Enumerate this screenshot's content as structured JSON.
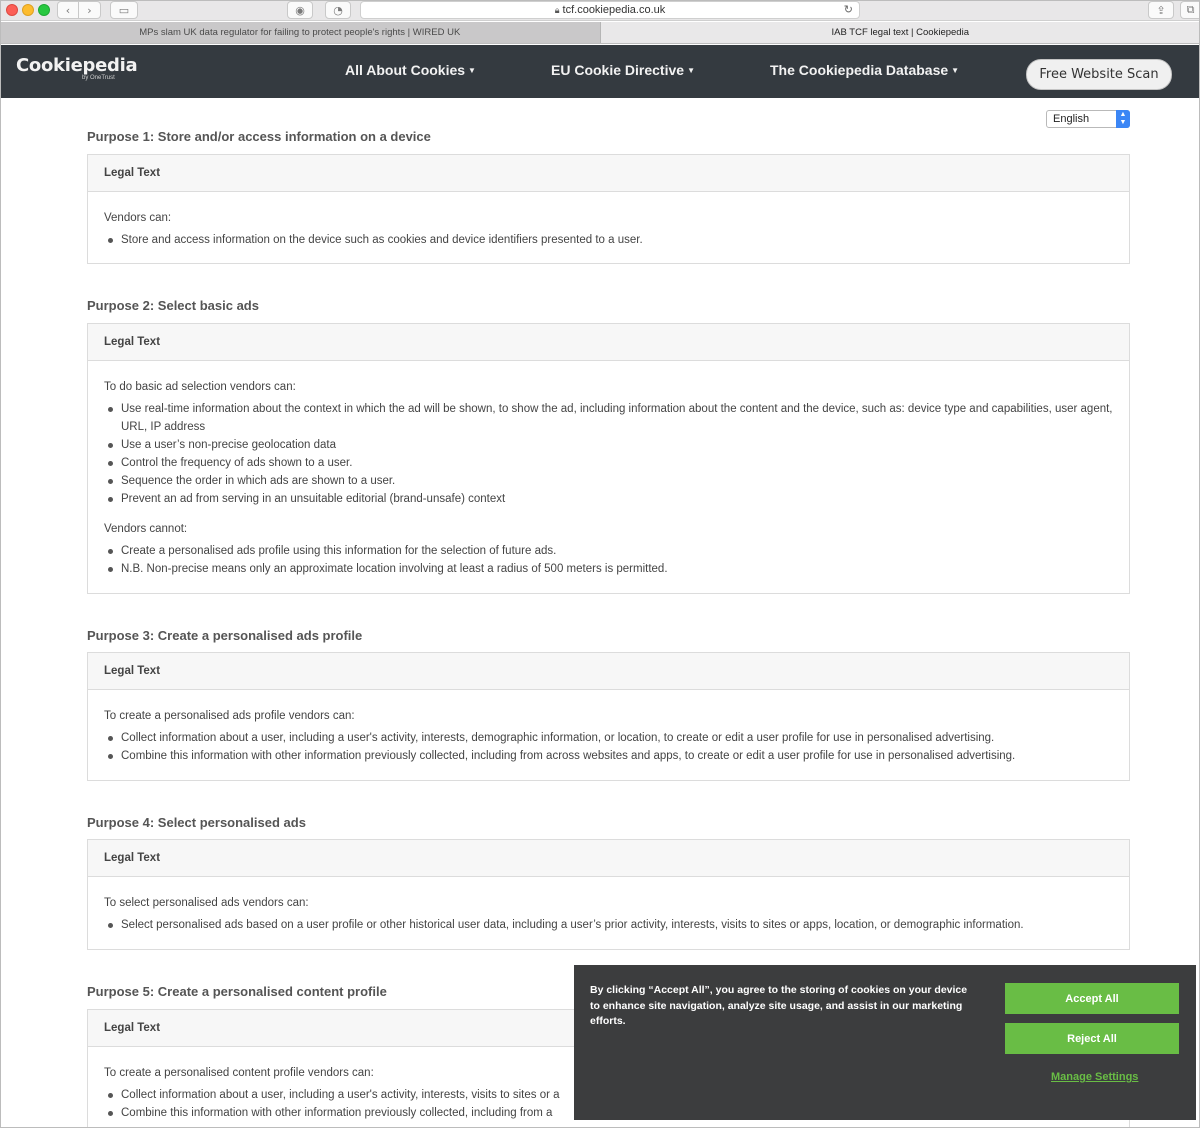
{
  "browser": {
    "url": "tcf.cookiepedia.co.uk",
    "tabs": [
      {
        "label": "MPs slam UK data regulator for failing to protect people's rights | WIRED UK",
        "active": false
      },
      {
        "label": "IAB TCF legal text | Cookiepedia",
        "active": true
      }
    ]
  },
  "header": {
    "logo": "Cookiepedia",
    "logo_sub": "by OneTrust",
    "nav": [
      "All About Cookies",
      "EU Cookie Directive",
      "The Cookiepedia Database"
    ],
    "scan_button": "Free Website Scan"
  },
  "language": {
    "selected": "English"
  },
  "purposes": [
    {
      "title": "Purpose 1: Store and/or access information on a device",
      "card_header": "Legal Text",
      "intro": "Vendors can:",
      "items": [
        "Store and access information on the device such as cookies and device identifiers presented to a user."
      ]
    },
    {
      "title": "Purpose 2: Select basic ads",
      "card_header": "Legal Text",
      "intro": "To do basic ad selection vendors can:",
      "items": [
        "Use real-time information about the context in which the ad will be shown, to show the ad, including information about the content and the device, such as: device type and capabilities, user agent, URL, IP address",
        "Use a user’s non-precise geolocation data",
        "Control the frequency of ads shown to a user.",
        "Sequence the order in which ads are shown to a user.",
        "Prevent an ad from serving in an unsuitable editorial (brand-unsafe) context"
      ],
      "intro2": "Vendors cannot:",
      "items2": [
        "Create a personalised ads profile using this information for the selection of future ads.",
        "N.B. Non-precise means only an approximate location involving at least a radius of 500 meters is permitted."
      ]
    },
    {
      "title": "Purpose 3: Create a personalised ads profile",
      "card_header": "Legal Text",
      "intro": "To create a personalised ads profile vendors can:",
      "items": [
        "Collect information about a user, including a user's activity, interests, demographic information, or location, to create or edit a user profile for use in personalised advertising.",
        "Combine this information with other information previously collected, including from across websites and apps, to create or edit a user profile for use in personalised advertising."
      ]
    },
    {
      "title": "Purpose 4: Select personalised ads",
      "card_header": "Legal Text",
      "intro": "To select personalised ads vendors can:",
      "items": [
        "Select personalised ads based on a user profile or other historical user data, including a user’s prior activity, interests, visits to sites or apps, location, or demographic information."
      ]
    },
    {
      "title": "Purpose 5: Create a personalised content profile",
      "card_header": "Legal Text",
      "intro": "To create a personalised content profile vendors can:",
      "items": [
        "Collect information about a user, including a user's activity, interests, visits to sites or a",
        "Combine this information with other information previously collected, including from a"
      ]
    }
  ],
  "cookie_banner": {
    "text": "By clicking “Accept All”, you agree to the storing of cookies on your device to enhance site navigation, analyze site usage, and assist in our marketing efforts.",
    "accept": "Accept All",
    "reject": "Reject All",
    "manage": "Manage Settings",
    "accent_color": "#69bd45"
  }
}
